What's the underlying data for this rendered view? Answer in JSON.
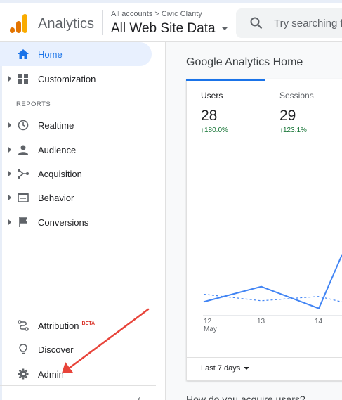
{
  "header": {
    "app_name": "Analytics",
    "breadcrumb_root": "All accounts",
    "breadcrumb_sep": ">",
    "breadcrumb_account": "Civic Clarity",
    "property": "All Web Site Data",
    "search_placeholder": "Try searching for",
    "logo_colors": [
      "#f9ab00",
      "#e37400"
    ]
  },
  "sidebar": {
    "home": "Home",
    "customization": "Customization",
    "reports_heading": "REPORTS",
    "reports": [
      "Realtime",
      "Audience",
      "Acquisition",
      "Behavior",
      "Conversions"
    ],
    "attribution": "Attribution",
    "attribution_badge": "BETA",
    "discover": "Discover",
    "admin": "Admin",
    "accent_color": "#1a73e8"
  },
  "main": {
    "title": "Google Analytics Home",
    "metrics": [
      {
        "name": "Users",
        "value": "28",
        "change": "180.0%"
      },
      {
        "name": "Sessions",
        "value": "29",
        "change": "123.1%"
      }
    ],
    "date_range": "Last 7 days",
    "next_section": "How do you acquire users?"
  },
  "chart_data": {
    "type": "line",
    "x_tick_labels": [
      "12",
      "May",
      "13",
      "14"
    ],
    "series": [
      {
        "line_style": "solid",
        "color": "#4285f4",
        "points": [
          [
            12,
            1.2
          ],
          [
            13,
            2.6
          ],
          [
            14,
            0.6
          ],
          [
            14.4,
            5.5
          ]
        ]
      },
      {
        "line_style": "dashed",
        "color": "#4285f4",
        "points": [
          [
            12,
            1.9
          ],
          [
            13,
            1.3
          ],
          [
            14,
            1.7
          ],
          [
            14.4,
            1.2
          ]
        ]
      }
    ],
    "y_range": [
      0,
      6
    ],
    "grid": true,
    "legend": "none"
  },
  "annotation": {
    "arrow_color": "#e8443a"
  }
}
